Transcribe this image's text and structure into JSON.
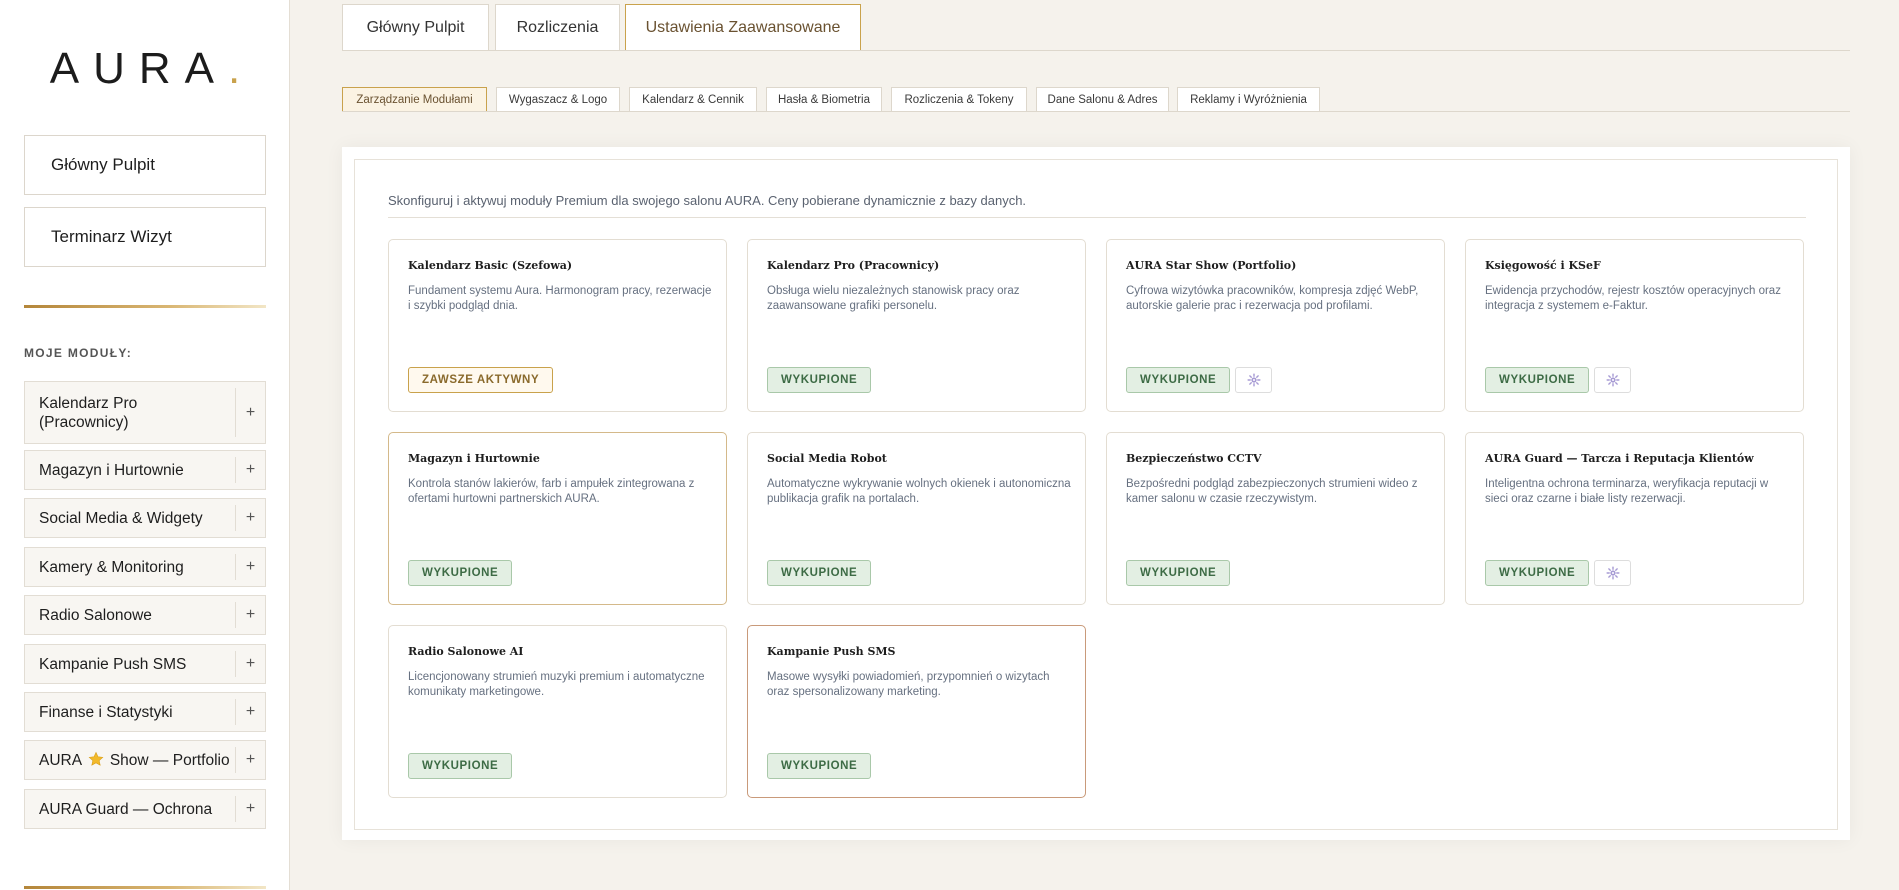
{
  "brand": {
    "name": "AURA",
    "dot": "."
  },
  "sidebar": {
    "main_buttons": [
      "Główny Pulpit",
      "Terminarz Wizyt"
    ],
    "section_label": "MOJE MODUŁY:",
    "modules": [
      {
        "label": "Kalendarz Pro (Pracownicy)"
      },
      {
        "label": "Magazyn i Hurtownie"
      },
      {
        "label": "Social Media & Widgety"
      },
      {
        "label": "Kamery & Monitoring"
      },
      {
        "label": "Radio Salonowe"
      },
      {
        "label": "Kampanie Push SMS"
      },
      {
        "label": "Finanse i Statystyki"
      },
      {
        "label_before": "AURA",
        "label_after": "Show — Portfolio",
        "icon": "star-icon"
      },
      {
        "label": "AURA Guard — Ochrona"
      }
    ],
    "plus_glyph": "+"
  },
  "top_tabs": [
    "Główny Pulpit",
    "Rozliczenia",
    "Ustawienia Zaawansowane"
  ],
  "sub_tabs": [
    "Zarządzanie Modułami",
    "Wygaszacz & Logo",
    "Kalendarz & Cennik",
    "Hasła & Biometria",
    "Rozliczenia & Tokeny",
    "Dane Salonu & Adres",
    "Reklamy i Wyróżnienia"
  ],
  "panel": {
    "intro": "Skonfiguruj i aktywuj moduły Premium dla swojego salonu AURA. Ceny pobierane dynamicznie z bazy danych."
  },
  "cards": [
    {
      "title": "Kalendarz Basic (Szefowa)",
      "desc": "Fundament systemu Aura. Harmonogram pracy, rezerwacje i szybki podgląd dnia.",
      "badge": "ZAWSZE AKTYWNY",
      "status": "always",
      "gear": false
    },
    {
      "title": "Kalendarz Pro (Pracownicy)",
      "desc": "Obsługa wielu niezależnych stanowisk pracy oraz zaawansowane grafiki personelu.",
      "badge": "WYKUPIONE",
      "status": "owned",
      "gear": false
    },
    {
      "title": "AURA Star Show (Portfolio)",
      "desc": "Cyfrowa wizytówka pracowników, kompresja zdjęć WebP, autorskie galerie prac i rezerwacja pod profilami.",
      "badge": "WYKUPIONE",
      "status": "owned",
      "gear": true
    },
    {
      "title": "Księgowość i KSeF",
      "desc": "Ewidencja przychodów, rejestr kosztów operacyjnych oraz integracja z systemem e-Faktur.",
      "badge": "WYKUPIONE",
      "status": "owned",
      "gear": true
    },
    {
      "title": "Magazyn i Hurtownie",
      "desc": "Kontrola stanów lakierów, farb i ampułek zintegrowana z ofertami hurtowni partnerskich AURA.",
      "badge": "WYKUPIONE",
      "status": "owned",
      "gear": false
    },
    {
      "title": "Social Media Robot",
      "desc": "Automatyczne wykrywanie wolnych okienek i autonomiczna publikacja grafik na portalach.",
      "badge": "WYKUPIONE",
      "status": "owned",
      "gear": false
    },
    {
      "title": "Bezpieczeństwo CCTV",
      "desc": "Bezpośredni podgląd zabezpieczonych strumieni wideo z kamer salonu w czasie rzeczywistym.",
      "badge": "WYKUPIONE",
      "status": "owned",
      "gear": false
    },
    {
      "title": "AURA Guard — Tarcza i Reputacja Klientów",
      "desc": "Inteligentna ochrona terminarza, weryfikacja reputacji w sieci oraz czarne i białe listy rezerwacji.",
      "badge": "WYKUPIONE",
      "status": "owned",
      "gear": true
    },
    {
      "title": "Radio Salonowe AI",
      "desc": "Licencjonowany strumień muzyki premium i automatyczne komunikaty marketingowe.",
      "badge": "WYKUPIONE",
      "status": "owned",
      "gear": false
    },
    {
      "title": "Kampanie Push SMS",
      "desc": "Masowe wysyłki powiadomień, przypomnień o wizytach oraz spersonalizowany marketing.",
      "badge": "WYKUPIONE",
      "status": "owned",
      "gear": false
    }
  ],
  "colors": {
    "accent_gold": "#c9a24c",
    "owned_green": "#3d6b45",
    "background": "#f5f2ec"
  }
}
